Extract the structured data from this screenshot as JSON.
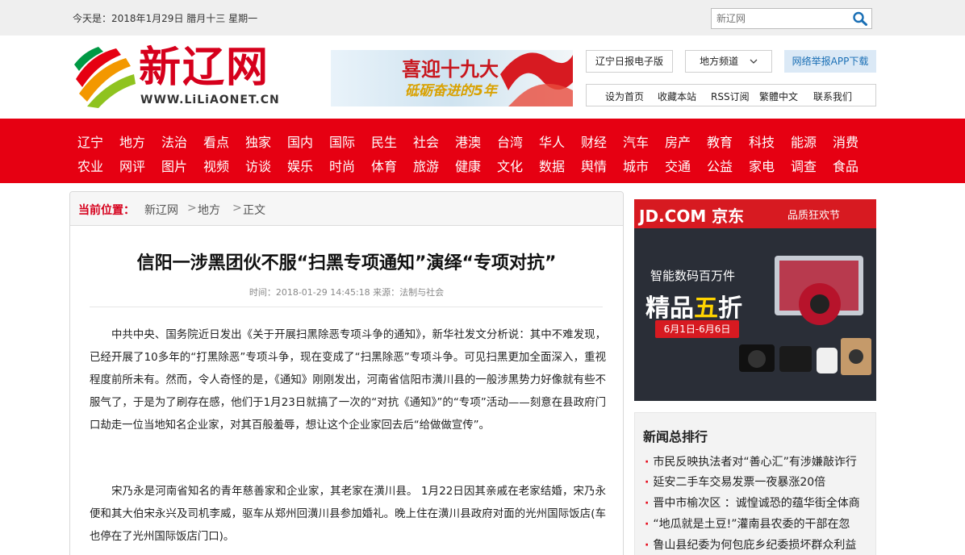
{
  "topbar": {
    "date": "今天是：2018年1月29日  腊月十三  星期一",
    "search_placeholder": "新辽网"
  },
  "logo": {
    "cn": "新辽网",
    "en": "WWW.LiLiAONET.CN"
  },
  "banner": {
    "line1": "喜迎十九大",
    "line2": "砥砺奋进的5年"
  },
  "header_buttons": {
    "epaper": "辽宁日报电子版",
    "channels": "地方频道",
    "app": "网络举报APP下载"
  },
  "header_links": [
    "设为首页",
    "收藏本站",
    "RSS订阅",
    "繁體中文",
    "联系我们"
  ],
  "nav": {
    "row1": [
      "辽宁",
      "地方",
      "法治",
      "看点",
      "独家",
      "国内",
      "国际",
      "民生",
      "社会",
      "港澳",
      "台湾",
      "华人",
      "财经",
      "汽车",
      "房产",
      "教育",
      "科技",
      "能源",
      "消费"
    ],
    "row2": [
      "农业",
      "网评",
      "图片",
      "视频",
      "访谈",
      "娱乐",
      "时尚",
      "体育",
      "旅游",
      "健康",
      "文化",
      "数据",
      "舆情",
      "城市",
      "交通",
      "公益",
      "家电",
      "调查",
      "食品"
    ]
  },
  "breadcrumb": {
    "label": "当前位置：",
    "items": [
      "新辽网",
      "地方",
      "正文"
    ],
    "sep": ">"
  },
  "article": {
    "title": "信阳一涉黑团伙不服“扫黑专项通知”演绎“专项对抗”",
    "meta": "时间：2018-01-29 14:45:18    来源：法制与社会",
    "para1": "　　中共中央、国务院近日发出《关于开展扫黑除恶专项斗争的通知》，新华社发文分析说：其中不难发现，已经开展了10多年的“打黑除恶”专项斗争，现在变成了“扫黑除恶”专项斗争。可见扫黑更加全面深入，重视程度前所未有。然而，令人奇怪的是，《通知》刚刚发出，河南省信阳市潢川县的一般涉黑势力好像就有些不服气了，于是为了刷存在感，他们于1月23日就搞了一次的“对抗《通知》”的“专项”活动——刻意在县政府门口劫走一位当地知名企业家，对其百般羞辱，想让这个企业家回去后“给做做宣传”。",
    "para2": "　　宋乃永是河南省知名的青年慈善家和企业家，其老家在潢川县。 1月22日因其亲戚在老家结婚，宋乃永便和其大伯宋永兴及司机李威，驱车从郑州回潢川县参加婚礼。晚上住在潢川县政府对面的光州国际饭店(车也停在了光州国际饭店门口)。"
  },
  "ad": {
    "brand": "JD.COM 京东",
    "headline": "品质狂欢节",
    "sub": "智能数码百万件",
    "main_a": "精品",
    "main_b": "五",
    "main_c": "折",
    "dates": "6月1日-6月6日"
  },
  "ranking": {
    "title": "新闻总排行",
    "items": [
      "市民反映执法者对“善心汇”有涉嫌敲诈行",
      "延安二手车交易发票一夜暴涨20倍",
      "晋中市榆次区 ：诚惶诚恐的蕴华街全体商",
      "“地瓜就是土豆!”灌南县农委的干部在忽",
      "鲁山县纪委为何包庇乡纪委损坏群众利益"
    ]
  },
  "colors": {
    "brand_red": "#e60012",
    "link_blue": "#1a6fb5"
  }
}
